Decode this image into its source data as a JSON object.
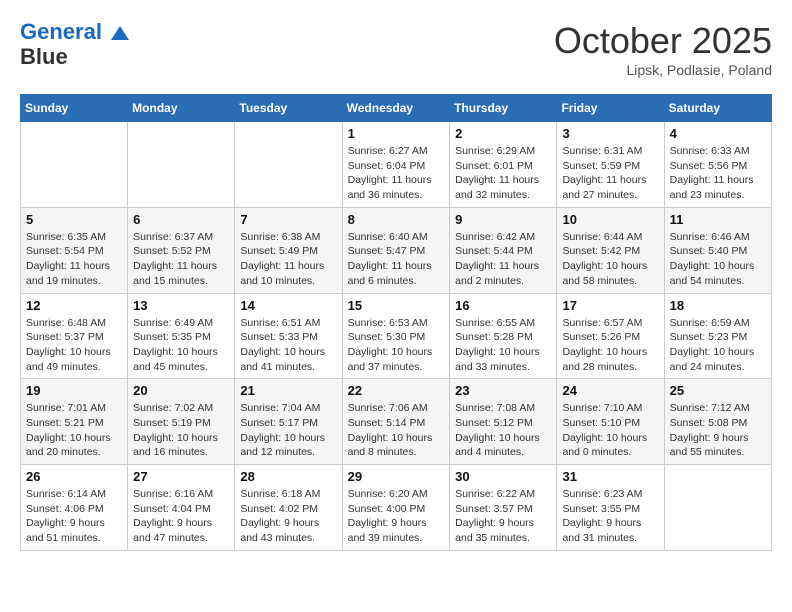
{
  "logo": {
    "line1": "General",
    "line2": "Blue"
  },
  "title": "October 2025",
  "subtitle": "Lipsk, Podlasie, Poland",
  "days_header": [
    "Sunday",
    "Monday",
    "Tuesday",
    "Wednesday",
    "Thursday",
    "Friday",
    "Saturday"
  ],
  "weeks": [
    [
      {
        "day": "",
        "info": ""
      },
      {
        "day": "",
        "info": ""
      },
      {
        "day": "",
        "info": ""
      },
      {
        "day": "1",
        "info": "Sunrise: 6:27 AM\nSunset: 6:04 PM\nDaylight: 11 hours and 36 minutes."
      },
      {
        "day": "2",
        "info": "Sunrise: 6:29 AM\nSunset: 6:01 PM\nDaylight: 11 hours and 32 minutes."
      },
      {
        "day": "3",
        "info": "Sunrise: 6:31 AM\nSunset: 5:59 PM\nDaylight: 11 hours and 27 minutes."
      },
      {
        "day": "4",
        "info": "Sunrise: 6:33 AM\nSunset: 5:56 PM\nDaylight: 11 hours and 23 minutes."
      }
    ],
    [
      {
        "day": "5",
        "info": "Sunrise: 6:35 AM\nSunset: 5:54 PM\nDaylight: 11 hours and 19 minutes."
      },
      {
        "day": "6",
        "info": "Sunrise: 6:37 AM\nSunset: 5:52 PM\nDaylight: 11 hours and 15 minutes."
      },
      {
        "day": "7",
        "info": "Sunrise: 6:38 AM\nSunset: 5:49 PM\nDaylight: 11 hours and 10 minutes."
      },
      {
        "day": "8",
        "info": "Sunrise: 6:40 AM\nSunset: 5:47 PM\nDaylight: 11 hours and 6 minutes."
      },
      {
        "day": "9",
        "info": "Sunrise: 6:42 AM\nSunset: 5:44 PM\nDaylight: 11 hours and 2 minutes."
      },
      {
        "day": "10",
        "info": "Sunrise: 6:44 AM\nSunset: 5:42 PM\nDaylight: 10 hours and 58 minutes."
      },
      {
        "day": "11",
        "info": "Sunrise: 6:46 AM\nSunset: 5:40 PM\nDaylight: 10 hours and 54 minutes."
      }
    ],
    [
      {
        "day": "12",
        "info": "Sunrise: 6:48 AM\nSunset: 5:37 PM\nDaylight: 10 hours and 49 minutes."
      },
      {
        "day": "13",
        "info": "Sunrise: 6:49 AM\nSunset: 5:35 PM\nDaylight: 10 hours and 45 minutes."
      },
      {
        "day": "14",
        "info": "Sunrise: 6:51 AM\nSunset: 5:33 PM\nDaylight: 10 hours and 41 minutes."
      },
      {
        "day": "15",
        "info": "Sunrise: 6:53 AM\nSunset: 5:30 PM\nDaylight: 10 hours and 37 minutes."
      },
      {
        "day": "16",
        "info": "Sunrise: 6:55 AM\nSunset: 5:28 PM\nDaylight: 10 hours and 33 minutes."
      },
      {
        "day": "17",
        "info": "Sunrise: 6:57 AM\nSunset: 5:26 PM\nDaylight: 10 hours and 28 minutes."
      },
      {
        "day": "18",
        "info": "Sunrise: 6:59 AM\nSunset: 5:23 PM\nDaylight: 10 hours and 24 minutes."
      }
    ],
    [
      {
        "day": "19",
        "info": "Sunrise: 7:01 AM\nSunset: 5:21 PM\nDaylight: 10 hours and 20 minutes."
      },
      {
        "day": "20",
        "info": "Sunrise: 7:02 AM\nSunset: 5:19 PM\nDaylight: 10 hours and 16 minutes."
      },
      {
        "day": "21",
        "info": "Sunrise: 7:04 AM\nSunset: 5:17 PM\nDaylight: 10 hours and 12 minutes."
      },
      {
        "day": "22",
        "info": "Sunrise: 7:06 AM\nSunset: 5:14 PM\nDaylight: 10 hours and 8 minutes."
      },
      {
        "day": "23",
        "info": "Sunrise: 7:08 AM\nSunset: 5:12 PM\nDaylight: 10 hours and 4 minutes."
      },
      {
        "day": "24",
        "info": "Sunrise: 7:10 AM\nSunset: 5:10 PM\nDaylight: 10 hours and 0 minutes."
      },
      {
        "day": "25",
        "info": "Sunrise: 7:12 AM\nSunset: 5:08 PM\nDaylight: 9 hours and 55 minutes."
      }
    ],
    [
      {
        "day": "26",
        "info": "Sunrise: 6:14 AM\nSunset: 4:06 PM\nDaylight: 9 hours and 51 minutes."
      },
      {
        "day": "27",
        "info": "Sunrise: 6:16 AM\nSunset: 4:04 PM\nDaylight: 9 hours and 47 minutes."
      },
      {
        "day": "28",
        "info": "Sunrise: 6:18 AM\nSunset: 4:02 PM\nDaylight: 9 hours and 43 minutes."
      },
      {
        "day": "29",
        "info": "Sunrise: 6:20 AM\nSunset: 4:00 PM\nDaylight: 9 hours and 39 minutes."
      },
      {
        "day": "30",
        "info": "Sunrise: 6:22 AM\nSunset: 3:57 PM\nDaylight: 9 hours and 35 minutes."
      },
      {
        "day": "31",
        "info": "Sunrise: 6:23 AM\nSunset: 3:55 PM\nDaylight: 9 hours and 31 minutes."
      },
      {
        "day": "",
        "info": ""
      }
    ]
  ]
}
